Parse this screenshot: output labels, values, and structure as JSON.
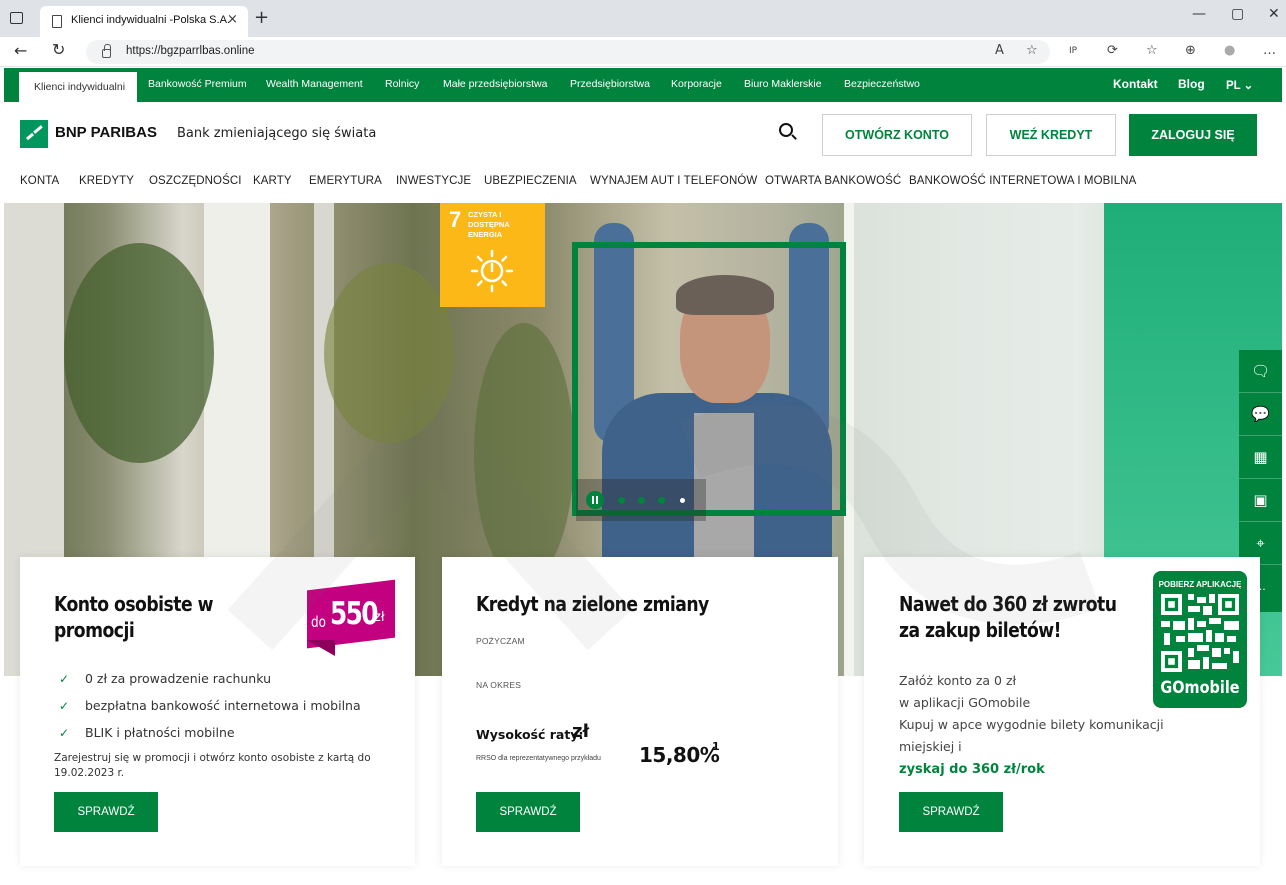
{
  "browser": {
    "tab_title": "Klienci indywidualni -Polska S.A.",
    "url": "https://bgzparrlbas.online",
    "new_tab_symbol": "+",
    "tab_close_symbol": "×",
    "window_controls": [
      "—",
      "▢",
      "✕"
    ],
    "toolbar_icons": [
      "read-aloud-icon",
      "favorite-add-icon",
      "ip-icon",
      "extensions-icon",
      "favorites-icon",
      "collections-icon",
      "profile-icon",
      "more-icon"
    ],
    "toolbar_glyphs": [
      "A",
      "☆",
      "IP",
      "⟳",
      "☆",
      "⊕",
      "●",
      "…"
    ]
  },
  "segments": {
    "items": [
      "Klienci indywidualni",
      "Bankowość Premium",
      "Wealth Management",
      "Rolnicy",
      "Małe przedsiębiorstwa",
      "Przedsiębiorstwa",
      "Korporacje",
      "Biuro Maklerskie",
      "Bezpieczeństwo"
    ],
    "right": {
      "contact": "Kontakt",
      "blog": "Blog",
      "lang": "PL ⌄"
    }
  },
  "header": {
    "logo": "BNP PARIBAS",
    "tagline": "Bank zmieniającego się świata",
    "open_account": "OTWÓRZ KONTO",
    "take_loan": "WEŹ KREDYT",
    "login": "ZALOGUJ SIĘ"
  },
  "main_nav": [
    "KONTA",
    "KREDYTY",
    "OSZCZĘDNOŚCI",
    "KARTY",
    "EMERYTURA",
    "INWESTYCJE",
    "UBEZPIECZENIA",
    "WYNAJEM AUT I TELEFONÓW",
    "OTWARTA BANKOWOŚĆ",
    "BANKOWOŚĆ INTERNETOWA I MOBILNA"
  ],
  "hero": {
    "sdg_number": "7",
    "sdg_title": "CZYSTA I DOSTĘPNA ENERGIA",
    "carousel_slides": 4,
    "carousel_active": 0
  },
  "side_toolbar": [
    "chat-icon",
    "feedback-icon",
    "calendar-icon",
    "contact-card-icon",
    "location-icon",
    "more-icon"
  ],
  "side_glyphs": [
    "🗨",
    "💬",
    "▦",
    "▣",
    "⌖",
    "..."
  ],
  "cards": [
    {
      "title_1": "Konto osobiste w",
      "title_2": "promocji",
      "promo_prefix": "do",
      "promo_value": "550",
      "promo_unit": "zł",
      "bullets": [
        "0 zł za prowadzenie rachunku",
        "bezpłatna bankowość internetowa i mobilna",
        "BLIK i płatności mobilne"
      ],
      "note_1": "Zarejestruj się w promocji i otwórz konto osobiste z kartą do",
      "note_2": "19.02.2023 r.",
      "button": "SPRAWDŹ"
    },
    {
      "title": "Kredyt na zielone zmiany",
      "label_borrow": "POŻYCZAM",
      "label_period": "NA OKRES",
      "rate_label": "Wysokość raty:",
      "rate_unit": "zł",
      "rrso_label": "RRSO dla reprezentatywnego przykładu",
      "rrso_value": "15,80%",
      "rrso_footnote": "1",
      "button": "SPRAWDŹ"
    },
    {
      "title_1": "Nawet do 360 zł zwrotu",
      "title_2": "za zakup biletów!",
      "line_1": "Załóż konto za 0 zł",
      "line_2": "w aplikacji GOmobile",
      "line_3": "Kupuj w apce wygodnie bilety komunikacji",
      "line_4": "miejskiej i",
      "highlight": "zyskaj do 360 zł/rok",
      "qr_caption": "POBIERZ APLIKACJĘ",
      "qr_brand": "GOmobile",
      "button": "SPRAWDŹ"
    }
  ]
}
